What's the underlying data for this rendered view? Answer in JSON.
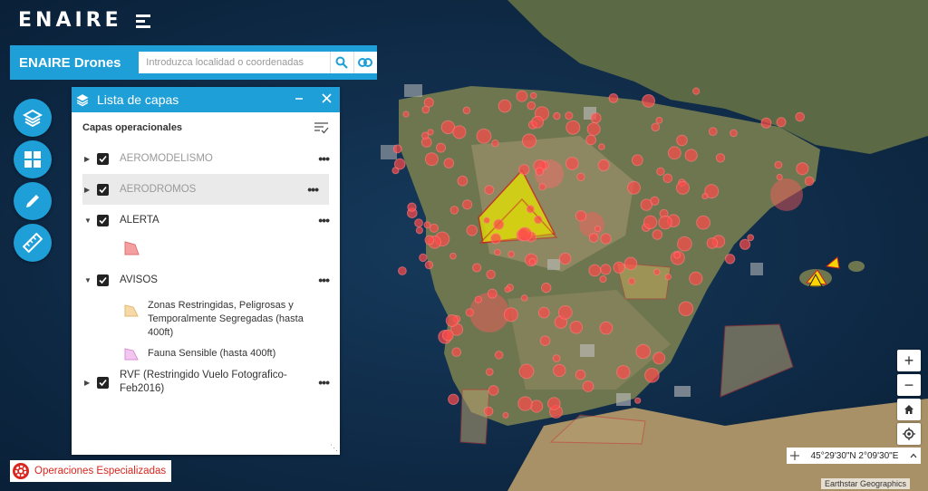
{
  "brand": {
    "logo_text": "ENAIRE"
  },
  "search": {
    "app_title": "ENAIRE Drones",
    "placeholder": "Introduzca localidad o coordenadas"
  },
  "toolbar": {
    "icons": [
      "layers-icon",
      "grid-icon",
      "pencil-icon",
      "ruler-icon"
    ]
  },
  "layers_panel": {
    "title": "Lista de capas",
    "section": "Capas operacionales",
    "layers": [
      {
        "label": "AEROMODELISMO",
        "checked": true
      },
      {
        "label": "AERODROMOS",
        "checked": true
      },
      {
        "label": "ALERTA",
        "checked": true
      },
      {
        "label": "AVISOS",
        "checked": true
      },
      {
        "label": "RVF (Restringido Vuelo Fotografico-Feb2016)",
        "checked": true
      }
    ],
    "avisos_legend": [
      {
        "label": "Zonas Restringidas, Peligrosas y Temporalmente Segregadas (hasta 400ft)",
        "color": "#f7d9a8"
      },
      {
        "label": "Fauna Sensible (hasta 400ft)",
        "color": "#f2c6f0"
      }
    ],
    "alerta_color": "#f4a0a0"
  },
  "operaciones": {
    "label": "Operaciones Especializadas"
  },
  "map_controls": {
    "zoom_in": "+",
    "zoom_out": "−"
  },
  "coordinates": {
    "text": "45°29'30\"N 2°09'30\"E"
  },
  "attribution": {
    "text": "Earthstar Geographics"
  },
  "colors": {
    "accent": "#1e9fd8",
    "marker": "#ff4a4a"
  }
}
